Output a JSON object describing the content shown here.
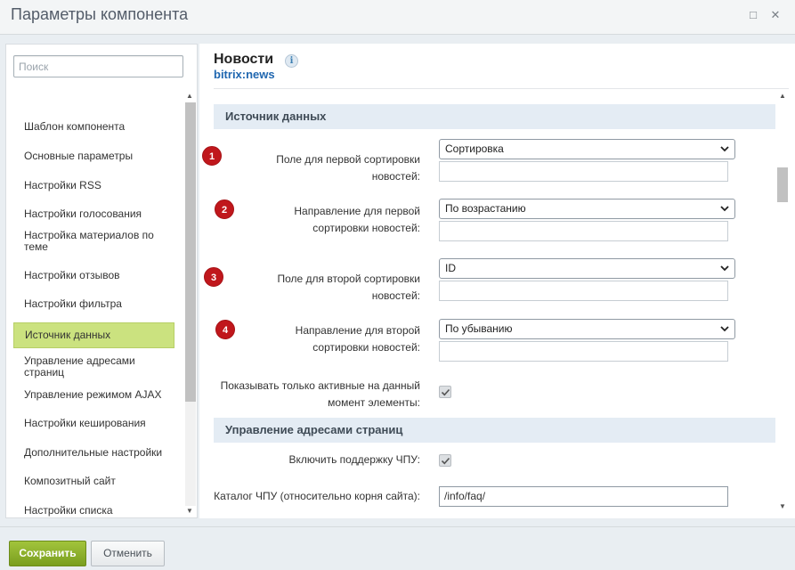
{
  "window": {
    "title": "Параметры компонента"
  },
  "sidebar": {
    "search_placeholder": "Поиск",
    "items": [
      {
        "label": "Шаблон компонента"
      },
      {
        "label": "Основные параметры"
      },
      {
        "label": "Настройки RSS"
      },
      {
        "label": "Настройки голосования"
      },
      {
        "label": "Настройка материалов по теме"
      },
      {
        "label": "Настройки отзывов"
      },
      {
        "label": "Настройки фильтра"
      },
      {
        "label": "Источник данных",
        "active": true
      },
      {
        "label": "Управление адресами страниц"
      },
      {
        "label": "Управление режимом AJAX"
      },
      {
        "label": "Настройки кеширования"
      },
      {
        "label": "Дополнительные настройки"
      },
      {
        "label": "Композитный сайт"
      },
      {
        "label": "Настройки списка"
      }
    ]
  },
  "component": {
    "name": "Новости",
    "code": "bitrix:news"
  },
  "sections": [
    {
      "title": "Источник данных",
      "fields": [
        {
          "badge": "1",
          "label": "Поле для первой сортировки новостей:",
          "select_value": "Сортировка",
          "extra_value": ""
        },
        {
          "badge": "2",
          "label": "Направление для первой сортировки новостей:",
          "select_value": "По возрастанию",
          "extra_value": ""
        },
        {
          "badge": "3",
          "label": "Поле для второй сортировки новостей:",
          "select_value": "ID",
          "extra_value": ""
        },
        {
          "badge": "4",
          "label": "Направление для второй сортировки новостей:",
          "select_value": "По убыванию",
          "extra_value": ""
        },
        {
          "label": "Показывать только активные на данный момент элементы:",
          "checked": true
        }
      ]
    },
    {
      "title": "Управление адресами страниц",
      "fields": [
        {
          "label": "Включить поддержку ЧПУ:",
          "checked": true
        },
        {
          "label": "Каталог ЧПУ (относительно корня сайта):",
          "value": "/info/faq/"
        }
      ]
    }
  ],
  "footer": {
    "save_label": "Сохранить",
    "cancel_label": "Отменить"
  },
  "colors": {
    "badge": "#c0171c",
    "active_item": "#cbe27f",
    "section_bg": "#e4ecf4",
    "save_button": "#8fb02e",
    "link_blue": "#2067b0"
  }
}
